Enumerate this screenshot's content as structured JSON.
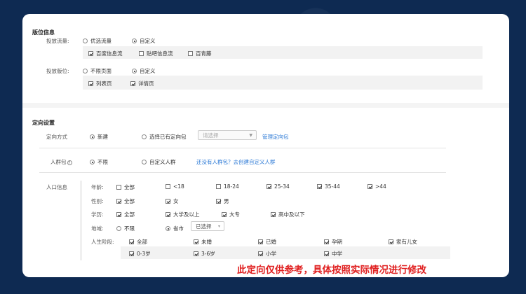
{
  "placement": {
    "title": "版位信息",
    "flow": {
      "label": "投放流量:",
      "options": [
        "优选流量",
        "自定义"
      ],
      "selected": 1,
      "checks": [
        {
          "label": "百度信息流",
          "checked": true
        },
        {
          "label": "贴吧信息流",
          "checked": false
        },
        {
          "label": "百青藤",
          "checked": false
        }
      ]
    },
    "slot": {
      "label": "投放版位:",
      "options": [
        "不限页面",
        "自定义"
      ],
      "selected": 1,
      "checks": [
        {
          "label": "列表页",
          "checked": true
        },
        {
          "label": "详情页",
          "checked": true
        }
      ]
    }
  },
  "targeting": {
    "title": "定向设置",
    "method": {
      "label": "定向方式",
      "options": [
        "新建",
        "选择已有定向包"
      ],
      "selected": 0,
      "select_placeholder": "请选择",
      "manage_link": "管理定向包"
    },
    "crowd": {
      "label": "人群包",
      "help": "?",
      "options": [
        "不限",
        "自定义人群"
      ],
      "selected": 0,
      "link": "还没有人群包？去创建自定义人群"
    },
    "demographics": {
      "label": "人口信息",
      "age": {
        "label": "年龄:",
        "items": [
          {
            "label": "全部",
            "checked": false
          },
          {
            "label": "<18",
            "checked": false
          },
          {
            "label": "18-24",
            "checked": false
          },
          {
            "label": "25-34",
            "checked": true
          },
          {
            "label": "35-44",
            "checked": true
          },
          {
            "label": ">44",
            "checked": true
          }
        ]
      },
      "gender": {
        "label": "性别:",
        "items": [
          {
            "label": "全部",
            "checked": true
          },
          {
            "label": "女",
            "checked": true
          },
          {
            "label": "男",
            "checked": true
          }
        ]
      },
      "education": {
        "label": "学历:",
        "items": [
          {
            "label": "全部",
            "checked": true
          },
          {
            "label": "大学及以上",
            "checked": true
          },
          {
            "label": "大专",
            "checked": true
          },
          {
            "label": "高中及以下",
            "checked": true
          }
        ]
      },
      "region": {
        "label": "地域:",
        "options": [
          "不限",
          "省市"
        ],
        "selected": 1,
        "select_value": "已选择"
      },
      "life_stage": {
        "label": "人生阶段:",
        "row1": [
          {
            "label": "全部",
            "checked": true
          },
          {
            "label": "未婚",
            "checked": true
          },
          {
            "label": "已婚",
            "checked": true
          },
          {
            "label": "孕期",
            "checked": true
          },
          {
            "label": "家有儿女",
            "checked": true
          }
        ],
        "row2": [
          {
            "label": "0-3岁",
            "checked": true
          },
          {
            "label": "3-6岁",
            "checked": true
          },
          {
            "label": "小学",
            "checked": true
          },
          {
            "label": "中学",
            "checked": true
          }
        ]
      }
    }
  },
  "caption": "此定向仅供参考，具体按照实际情况进行修改"
}
